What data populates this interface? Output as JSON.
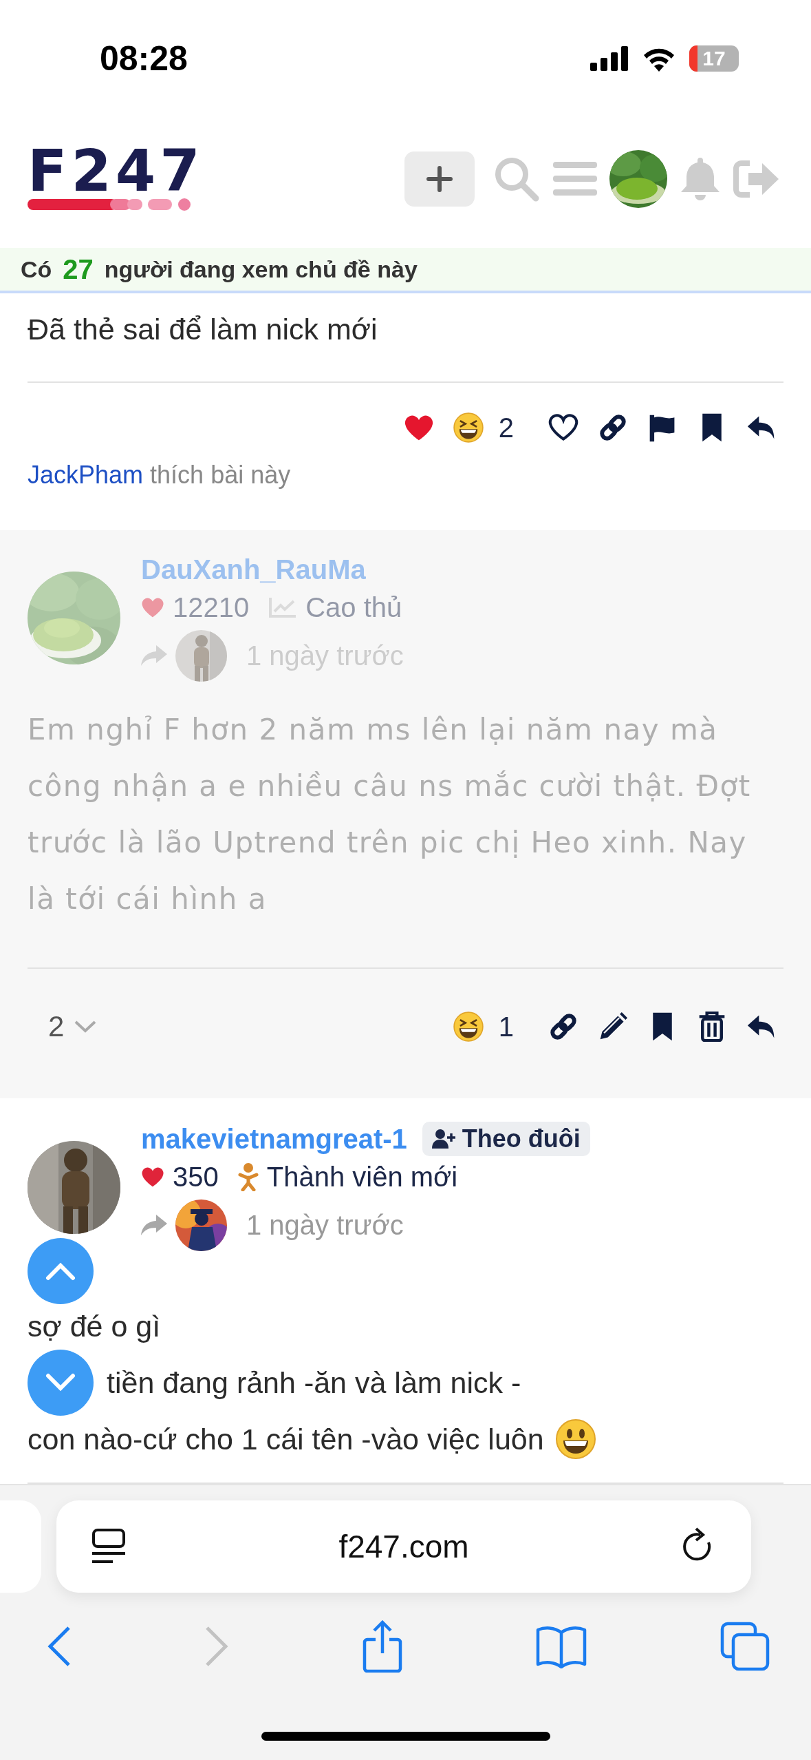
{
  "status_bar": {
    "time": "08:28",
    "battery": "17"
  },
  "header": {
    "logo": "F247"
  },
  "viewers_banner": {
    "prefix": "Có",
    "count": "27",
    "suffix": "người đang xem chủ đề này"
  },
  "posts": [
    {
      "body_lines": [
        {
          "text": "Đã thẻ sai để làm nick mới"
        }
      ],
      "reactions": [
        {
          "kind": "heart"
        },
        {
          "kind": "laugh"
        }
      ],
      "reaction_count": "2",
      "actions": [
        {
          "kind": "like"
        },
        {
          "kind": "link"
        },
        {
          "kind": "flag"
        },
        {
          "kind": "bookmark"
        },
        {
          "kind": "reply"
        }
      ],
      "liked_by": {
        "user": "JackPham",
        "text": "thích bài này"
      }
    },
    {
      "faded": true,
      "author": {
        "name": "DauXanh_RauMa",
        "likes": "12210",
        "rank": {
          "text": "Cao thủ",
          "kind": "chart"
        },
        "time": "1 ngày trước"
      },
      "body": "Em nghỉ F hơn 2 năm ms lên lại năm nay mà công nhận a e nhiều câu ns mắc cười thật. Đợt trước là lão Uptrend trên pic chị Heo xinh. Nay là tới cái hình a",
      "replies": "2",
      "reactions": [
        {
          "kind": "laugh"
        }
      ],
      "reaction_count": "1",
      "actions": [
        {
          "kind": "link"
        },
        {
          "kind": "edit"
        },
        {
          "kind": "bookmark"
        },
        {
          "kind": "delete"
        },
        {
          "kind": "reply"
        }
      ]
    },
    {
      "faded": false,
      "author": {
        "name": "makevietnamgreat-1",
        "follow": "Theo đuôi",
        "likes": "350",
        "rank": {
          "text": "Thành viên mới",
          "kind": "newbie"
        },
        "time": "1 ngày trước"
      },
      "body_lines": [
        {
          "text": "sợ đé o gì"
        },
        {
          "text": "tiền đang rảnh -ăn và làm nick -"
        },
        {
          "text": "con nào-cứ cho 1 cái tên -vào việc luôn",
          "emoji": {
            "kind": "grin"
          }
        }
      ]
    }
  ],
  "browser": {
    "url": "f247.com"
  }
}
